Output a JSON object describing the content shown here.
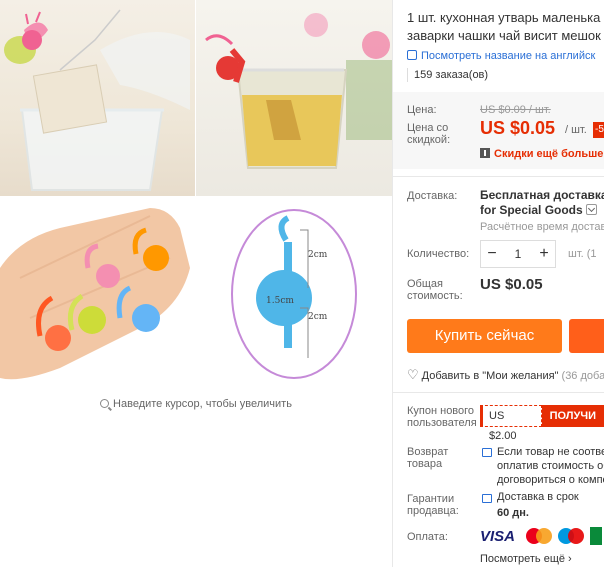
{
  "gallery": {
    "dim_labels": [
      "2cm",
      "1.5cm",
      "2cm"
    ],
    "zoom_hint": "Наведите курсор, чтобы увеличить"
  },
  "product": {
    "title_line1": "1 шт. кухонная утварь маленька",
    "title_line2": "заварки чашки чай висит мешок",
    "translate_link": "Посмотреть название на английск",
    "orders": "159 заказа(ов)"
  },
  "price": {
    "label_price": "Цена:",
    "old_price": "US $0.09 / шт.",
    "label_discount": "Цена со скидкой:",
    "price": "US $0.05",
    "per_unit": "/ шт.",
    "discount_badge": "-5",
    "coupon_note": "Скидки ещё больше в"
  },
  "shipping": {
    "label": "Доставка:",
    "value_line1": "Бесплатная доставка в",
    "value_line2": "for Special Goods",
    "time": "Расчётное время доставк"
  },
  "quantity": {
    "label": "Количество:",
    "minus": "−",
    "value": "1",
    "plus": "+",
    "unit": "шт. (1"
  },
  "total": {
    "label": "Общая стоимость:",
    "value": "US $0.05"
  },
  "actions": {
    "buy_now": "Купить сейчас",
    "wishlist": "Добавить в \"Мои желания\"",
    "wishlist_count": "(36 доба"
  },
  "coupon": {
    "label": "Купон нового пользователя",
    "amount": "US $2.00",
    "get": "ПОЛУЧИ"
  },
  "returns": {
    "label": "Возврат товара",
    "text_line1": "Если товар не соответ",
    "text_line2": "оплатив стоимость об",
    "text_line3": "договориться о компе"
  },
  "guarantee": {
    "label": "Гарантии продавца:",
    "text": "Доставка в срок",
    "days": "60 дн."
  },
  "payment": {
    "label": "Оплата:",
    "visa": "VISA",
    "see_all": "Посмотреть ещё ›"
  },
  "colors": {
    "accent_red": "#e62e04",
    "buy_orange": "#ff7a1a",
    "link_blue": "#2a6fd6"
  }
}
